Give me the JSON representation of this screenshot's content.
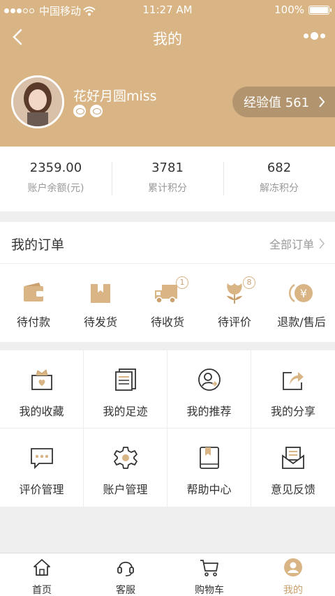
{
  "status_bar": {
    "carrier": "中国移动",
    "time": "11:27 AM",
    "battery": "100%"
  },
  "header": {
    "title": "我的"
  },
  "profile": {
    "username": "花好月圆miss",
    "experience": "经验值 561"
  },
  "account": [
    {
      "value": "2359.00",
      "label": "账户余额(元)"
    },
    {
      "value": "3781",
      "label": "累计积分"
    },
    {
      "value": "682",
      "label": "解冻积分"
    }
  ],
  "orders": {
    "title": "我的订单",
    "all_label": "全部订单",
    "items": [
      {
        "label": "待付款",
        "icon": "wallet-icon",
        "count": ""
      },
      {
        "label": "待发货",
        "icon": "box-icon",
        "count": ""
      },
      {
        "label": "待收货",
        "icon": "truck-icon",
        "count": "1"
      },
      {
        "label": "待评价",
        "icon": "flower-icon",
        "count": "8"
      },
      {
        "label": "退款/售后",
        "icon": "refund-icon",
        "count": ""
      }
    ]
  },
  "tools": [
    {
      "label": "我的收藏",
      "icon": "favorite-box-icon"
    },
    {
      "label": "我的足迹",
      "icon": "footprint-icon"
    },
    {
      "label": "我的推荐",
      "icon": "recommend-icon"
    },
    {
      "label": "我的分享",
      "icon": "share-icon"
    },
    {
      "label": "评价管理",
      "icon": "comment-icon"
    },
    {
      "label": "账户管理",
      "icon": "settings-gear-icon"
    },
    {
      "label": "帮助中心",
      "icon": "help-book-icon"
    },
    {
      "label": "意见反馈",
      "icon": "feedback-mail-icon"
    }
  ],
  "tabbar": [
    {
      "label": "首页",
      "icon": "home-icon"
    },
    {
      "label": "客服",
      "icon": "headset-icon"
    },
    {
      "label": "购物车",
      "icon": "cart-icon"
    },
    {
      "label": "我的",
      "icon": "user-icon",
      "active": true
    }
  ],
  "colors": {
    "brand": "#d9b585",
    "accent": "#c9a06e",
    "background": "#efefef"
  }
}
